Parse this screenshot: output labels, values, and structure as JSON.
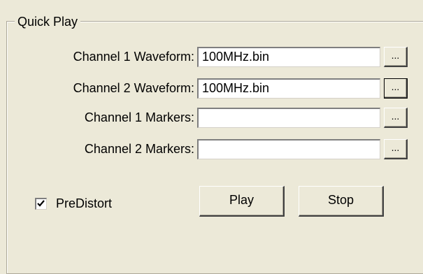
{
  "group": {
    "title": "Quick Play"
  },
  "rows": [
    {
      "label": "Channel 1 Waveform:",
      "value": "100MHz.bin",
      "browse_label": "..."
    },
    {
      "label": "Channel 2 Waveform:",
      "value": "100MHz.bin",
      "browse_label": "..."
    },
    {
      "label": "Channel 1 Markers:",
      "value": "",
      "browse_label": "..."
    },
    {
      "label": "Channel 2 Markers:",
      "value": "",
      "browse_label": "..."
    }
  ],
  "predistort": {
    "label": "PreDistort",
    "checked": true
  },
  "buttons": {
    "play": "Play",
    "stop": "Stop"
  },
  "colors": {
    "background": "#ECE9D8",
    "field": "#FFFFFF"
  }
}
